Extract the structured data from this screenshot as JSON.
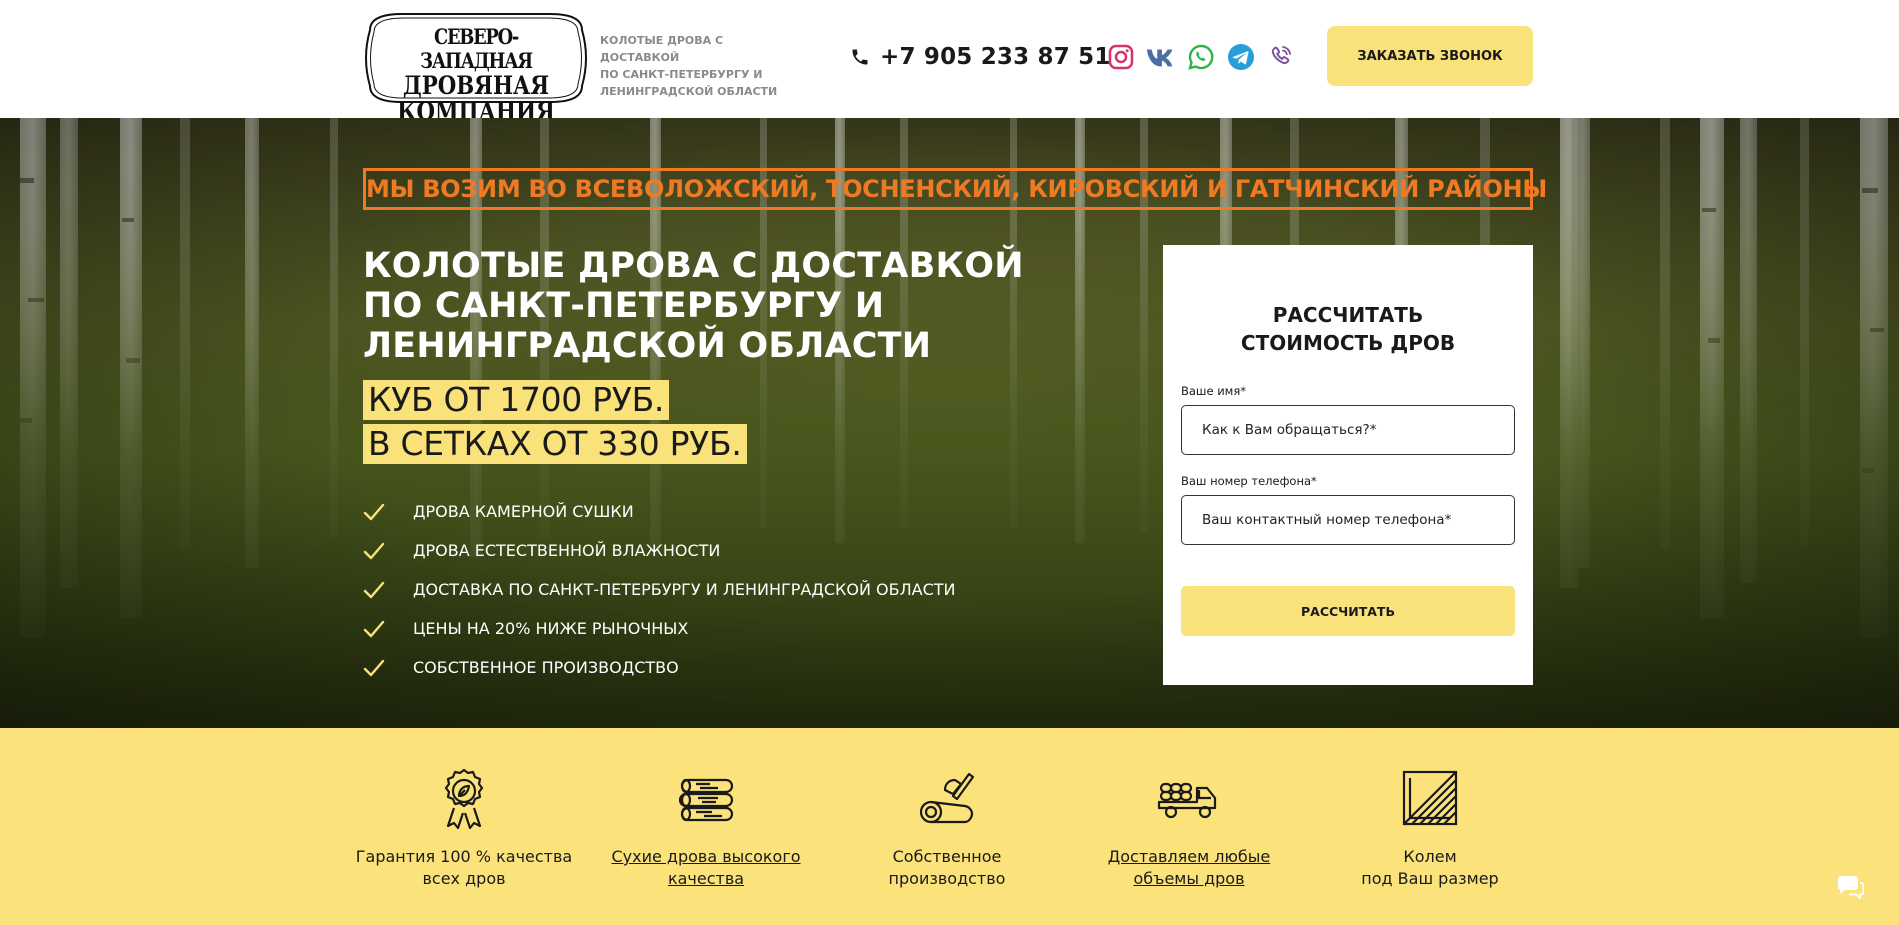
{
  "header": {
    "logo": {
      "line1": "СЕВЕРО-ЗАПАДНАЯ",
      "line2": "ДРОВЯНАЯ",
      "line3": "КОМПАНИЯ"
    },
    "tagline": [
      "КОЛОТЫЕ ДРОВА С ДОСТАВКОЙ",
      "ПО САНКТ-ПЕТЕРБУРГУ И",
      "ЛЕНИНГРАДСКОЙ ОБЛАСТИ"
    ],
    "phone": "+7 905 233 87 51",
    "socials": [
      "instagram-icon",
      "vk-icon",
      "whatsapp-icon",
      "telegram-icon",
      "viber-icon"
    ],
    "call_button": "ЗАКАЗАТЬ ЗВОНОК"
  },
  "hero": {
    "regions": "МЫ ВОЗИМ ВО ВСЕВОЛОЖСКИЙ, ТОСНЕНСКИЙ, КИРОВСКИЙ И ГАТЧИНСКИЙ РАЙОНЫ",
    "title": "КОЛОТЫЕ ДРОВА С ДОСТАВКОЙ ПО САНКТ-ПЕТЕРБУРГУ И ЛЕНИНГРАДСКОЙ ОБЛАСТИ",
    "price1": "КУБ ОТ 1700 РУБ.",
    "price2": "В СЕТКАХ ОТ 330 РУБ.",
    "features": [
      "ДРОВА КАМЕРНОЙ СУШКИ",
      "ДРОВА ЕСТЕСТВЕННОЙ ВЛАЖНОСТИ",
      "ДОСТАВКА ПО САНКТ-ПЕТЕРБУРГУ И ЛЕНИНГРАДСКОЙ ОБЛАСТИ",
      "ЦЕНЫ НА 20% НИЖЕ РЫНОЧНЫХ",
      "СОБСТВЕННОЕ ПРОИЗВОДСТВО"
    ]
  },
  "form": {
    "title_line1": "РАССЧИТАТЬ",
    "title_line2": "СТОИМОСТЬ ДРОВ",
    "name_label": "Ваше имя*",
    "name_placeholder": "Как к Вам обращаться?*",
    "phone_label": "Ваш номер телефона*",
    "phone_placeholder": "Ваш контактный номер телефона*",
    "submit": "РАССЧИТАТЬ"
  },
  "benefits": [
    {
      "icon": "quality-badge-icon",
      "line1": "Гарантия 100 % качества",
      "line2": "всех дров"
    },
    {
      "icon": "logs-icon",
      "line1": "Сухие дрова высокого",
      "line2": "качества"
    },
    {
      "icon": "axe-log-icon",
      "line1": "Собственное",
      "line2": "производство"
    },
    {
      "icon": "truck-logs-icon",
      "line1": "Доставляем любые",
      "line2": "объемы дров"
    },
    {
      "icon": "wood-cut-icon",
      "line1": "Колем",
      "line2": "под Ваш размер"
    }
  ],
  "colors": {
    "accent_yellow": "#f9e27a",
    "accent_orange": "#ef7a24",
    "dark_text": "#1a1a1a"
  }
}
